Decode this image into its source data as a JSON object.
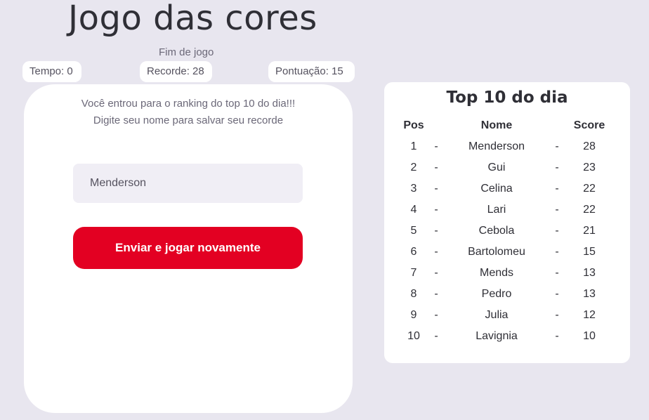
{
  "title": "Jogo das cores",
  "status": "Fim de jogo",
  "stats": {
    "time": "Tempo: 0",
    "record": "Recorde: 28",
    "score": "Pontuação: 15"
  },
  "game_over": {
    "message_line1": "Você entrou para o ranking do top 10 do dia!!!",
    "message_line2": "Digite seu nome para salvar seu recorde",
    "name_value": "Menderson",
    "submit_label": "Enviar e jogar novamente"
  },
  "ranking": {
    "title": "Top 10 do dia",
    "headers": {
      "pos": "Pos",
      "name": "Nome",
      "score": "Score"
    },
    "separator": "-",
    "rows": [
      {
        "pos": "1",
        "name": "Menderson",
        "score": "28"
      },
      {
        "pos": "2",
        "name": "Gui",
        "score": "23"
      },
      {
        "pos": "3",
        "name": "Celina",
        "score": "22"
      },
      {
        "pos": "4",
        "name": "Lari",
        "score": "22"
      },
      {
        "pos": "5",
        "name": "Cebola",
        "score": "21"
      },
      {
        "pos": "6",
        "name": "Bartolomeu",
        "score": "15"
      },
      {
        "pos": "7",
        "name": "Mends",
        "score": "13"
      },
      {
        "pos": "8",
        "name": "Pedro",
        "score": "13"
      },
      {
        "pos": "9",
        "name": "Julia",
        "score": "12"
      },
      {
        "pos": "10",
        "name": "Lavignia",
        "score": "10"
      }
    ]
  },
  "colors": {
    "background": "#e8e6ef",
    "accent": "#e30022",
    "text": "#2f2f36",
    "muted": "#6b6878"
  }
}
